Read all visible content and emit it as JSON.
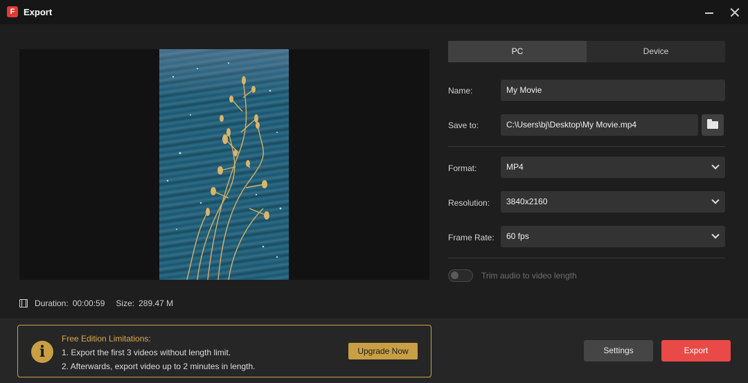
{
  "window": {
    "title": "Export",
    "app_icon": "app-logo-icon",
    "controls": [
      "minimize-icon",
      "close-icon"
    ]
  },
  "preview": {
    "duration_label": "Duration:",
    "duration": "00:00:59",
    "size_label": "Size:",
    "size": "289.47 M",
    "info_icon": "film-icon"
  },
  "tabs": [
    {
      "label": "PC",
      "active": true
    },
    {
      "label": "Device",
      "active": false
    }
  ],
  "form": {
    "name_label": "Name:",
    "name_value": "My Movie",
    "save_label": "Save to:",
    "save_value": "C:\\Users\\bj\\Desktop\\My Movie.mp4",
    "folder_icon": "folder-icon",
    "format_label": "Format:",
    "format_value": "MP4",
    "resolution_label": "Resolution:",
    "resolution_value": "3840x2160",
    "framerate_label": "Frame Rate:",
    "framerate_value": "60 fps",
    "trim_label": "Trim audio to video length",
    "trim_enabled": false
  },
  "limitations": {
    "title": "Free Edition Limitations:",
    "line1": "1. Export the first 3 videos without length limit.",
    "line2": "2. Afterwards, export video up to 2 minutes in length.",
    "upgrade_label": "Upgrade Now",
    "icon": "info-icon"
  },
  "actions": {
    "settings_label": "Settings",
    "export_label": "Export"
  },
  "colors": {
    "accent_export": "#e94a47",
    "accent_gold": "#c99f45",
    "background": "#1e1e1e"
  }
}
